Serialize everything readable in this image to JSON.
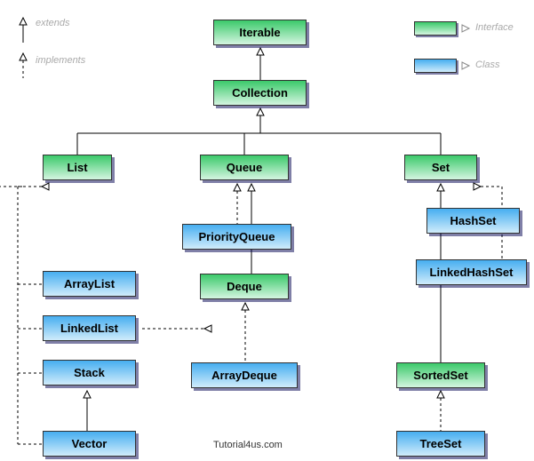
{
  "legend": {
    "extends": "extends",
    "implements": "implements",
    "interface": "Interface",
    "class": "Class"
  },
  "nodes": {
    "iterable": "Iterable",
    "collection": "Collection",
    "list": "List",
    "queue": "Queue",
    "set": "Set",
    "priorityqueue": "PriorityQueue",
    "arraylist": "ArrayList",
    "linkedlist": "LinkedList",
    "stack": "Stack",
    "vector": "Vector",
    "deque": "Deque",
    "arraydeque": "ArrayDeque",
    "hashset": "HashSet",
    "linkedhashset": "LinkedHashSet",
    "sortedset": "SortedSet",
    "treeset": "TreeSet"
  },
  "credit": "Tutorial4us.com",
  "colors": {
    "interface_top": "#3bc96a",
    "class_top": "#46aef0"
  }
}
